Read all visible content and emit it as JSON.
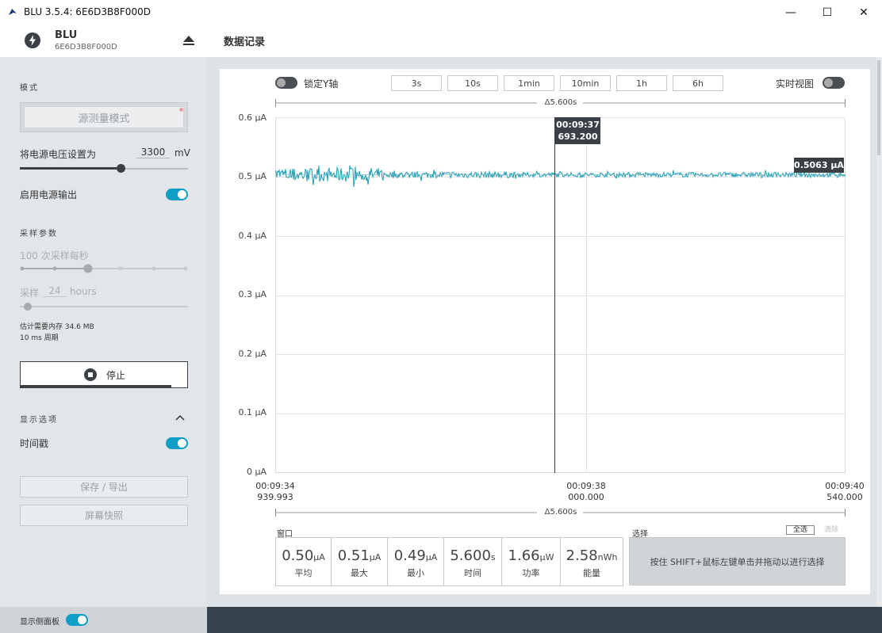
{
  "window": {
    "title": "BLU 3.5.4: 6E6D3B8F000D",
    "minimize": "—",
    "maximize": "☐",
    "close": "✕"
  },
  "header": {
    "device_name": "BLU",
    "device_id": "6E6D3B8F000D",
    "page_title": "数据记录"
  },
  "sidebar": {
    "mode_title": "模式",
    "mode_button": "源测量模式",
    "voltage_label": "将电源电压设置为",
    "voltage_value": "3300",
    "voltage_unit": "mV",
    "voltage_slider_fraction": 0.6,
    "power_output_label": "启用电源输出",
    "power_output_on": true,
    "sampling_title": "采样参数",
    "rate_label": "100 次采样每秒",
    "sample_label": "采样",
    "sample_value": "24",
    "sample_unit": "hours",
    "memory_estimate": "估计需要内存 34.6 MB",
    "period": "10 ms 周期",
    "stop_button": "停止",
    "display_title": "显示选项",
    "timestamp_label": "时间戳",
    "timestamp_on": true,
    "save_button": "保存 / 导出",
    "screenshot_button": "屏幕快照",
    "show_sidebar_label": "显示侧面板",
    "show_sidebar_on": true
  },
  "toolbar": {
    "lock_y_label": "锁定Y轴",
    "lock_y_on": false,
    "time_buttons": [
      "3s",
      "10s",
      "1min",
      "10min",
      "1h",
      "6h"
    ],
    "live_view_label": "实时视图",
    "live_view_on": false
  },
  "chart_data": {
    "type": "line",
    "title": "",
    "xlabel": "",
    "ylabel": "",
    "y_unit": "μA",
    "ylim": [
      0,
      0.6
    ],
    "y_ticks": [
      "0.6 μA",
      "0.5 μA",
      "0.4 μA",
      "0.3 μA",
      "0.2 μA",
      "0.1 μA",
      "0 μA"
    ],
    "x_ticks": [
      {
        "time": "00:09:34",
        "ms": "939.993"
      },
      {
        "time": "00:09:38",
        "ms": "000.000"
      },
      {
        "time": "00:09:40",
        "ms": "540.000"
      }
    ],
    "window_span_top": "Δ5.600s",
    "window_span_bottom": "Δ5.600s",
    "cursor_time": "00:09:37",
    "cursor_ms": "693.200",
    "latest_value_label": "0.5063 μA",
    "series": [
      {
        "color": "#1a9db5",
        "mean": 0.503,
        "noise_early": 0.012,
        "noise_late": 0.004
      }
    ]
  },
  "stats": {
    "window_label": "窗口",
    "selection_label": "选择",
    "select_all": "全选",
    "clear": "清除",
    "selection_hint": "按住 SHIFT+鼠标左键单击并拖动以进行选择",
    "items": [
      {
        "value": "0.50",
        "unit": "μA",
        "name": "平均"
      },
      {
        "value": "0.51",
        "unit": "μA",
        "name": "最大"
      },
      {
        "value": "0.49",
        "unit": "μA",
        "name": "最小"
      },
      {
        "value": "5.600",
        "unit": "s",
        "name": "时间"
      },
      {
        "value": "1.66",
        "unit": "μW",
        "name": "功率"
      },
      {
        "value": "2.58",
        "unit": "nWh",
        "name": "能量"
      }
    ]
  }
}
